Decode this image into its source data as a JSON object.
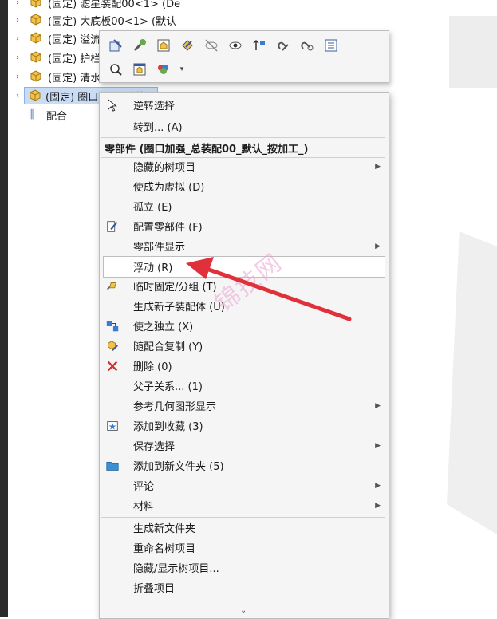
{
  "tree": {
    "items": [
      {
        "label": "(固定) 滤星装配00<1> (De"
      },
      {
        "label": "(固定) 大底板00<1> (默认"
      },
      {
        "label": "(固定) 溢流"
      },
      {
        "label": "(固定) 护栏"
      },
      {
        "label": "(固定) 清水"
      },
      {
        "label": "(固定) 圈口加强_总装配"
      }
    ],
    "mate_label": "配合"
  },
  "menu": {
    "reverse_select": "逆转选择",
    "goto": "转到... (A)",
    "header": "零部件 (圈口加强_总装配00_默认_按加工_)",
    "items": [
      {
        "label": "隐藏的树项目"
      },
      {
        "label": "使成为虚拟 (D)"
      },
      {
        "label": "孤立 (E)"
      },
      {
        "label": "配置零部件 (F)"
      },
      {
        "label": "零部件显示"
      },
      {
        "label": "浮动 (R)"
      },
      {
        "label": "临时固定/分组 (T)"
      },
      {
        "label": "生成新子装配体 (U)"
      },
      {
        "label": "使之独立 (X)"
      },
      {
        "label": "随配合复制 (Y)"
      },
      {
        "label": "删除 (0)"
      },
      {
        "label": "父子关系... (1)"
      },
      {
        "label": "参考几何图形显示"
      },
      {
        "label": "添加到收藏 (3)"
      },
      {
        "label": "保存选择"
      },
      {
        "label": "添加到新文件夹 (5)"
      },
      {
        "label": "评论"
      },
      {
        "label": "材料"
      }
    ],
    "tree_items": [
      {
        "label": "生成新文件夹"
      },
      {
        "label": "重命名树项目"
      },
      {
        "label": "隐藏/显示树项目..."
      },
      {
        "label": "折叠项目"
      }
    ]
  },
  "watermark": "锦技网",
  "colors": {
    "arrow": "#e0303a",
    "selection": "#c9dcf3",
    "watermark": "#e8a4d0"
  }
}
